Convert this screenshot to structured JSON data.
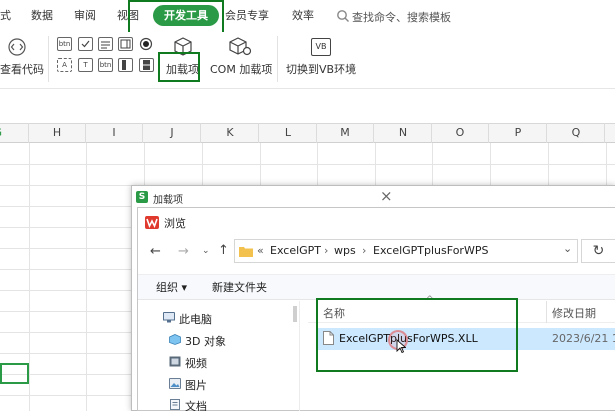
{
  "ribbon": {
    "tabs": [
      {
        "label": "式"
      },
      {
        "label": "数据"
      },
      {
        "label": "审阅"
      },
      {
        "label": "视图"
      },
      {
        "label": "开发工具"
      },
      {
        "label": "会员专享"
      },
      {
        "label": "效率"
      }
    ],
    "search_placeholder": "查找命令、搜索模板",
    "view_code": "查看代码",
    "addins": "加载项",
    "com_addins": "COM 加载项",
    "switch_vb": "切换到VB环境",
    "ctrl_btn": "btn",
    "ctrl_a": "A",
    "ctrl_t": "T",
    "ctrl_vb": "VB"
  },
  "sheet": {
    "columns": [
      "G",
      "H",
      "I",
      "J",
      "K",
      "L",
      "M",
      "N",
      "O",
      "P",
      "Q"
    ]
  },
  "addin_dialog": {
    "title": "加载项",
    "app_badge": "S",
    "close_glyph": "×"
  },
  "browse_dialog": {
    "title": "浏览",
    "breadcrumb_prefix": "«",
    "breadcrumb": [
      "ExcelGPT",
      "wps",
      "ExcelGPTplusForWPS"
    ],
    "organize": "组织 ▾",
    "new_folder": "新建文件夹",
    "sidebar": [
      "此电脑",
      "3D 对象",
      "视频",
      "图片",
      "文档"
    ],
    "column_name": "名称",
    "column_modified": "修改日期",
    "file": {
      "name": "ExcelGPTplusForWPS.XLL",
      "date": "2023/6/21 1"
    }
  },
  "colors": {
    "accent": "#2b9a46",
    "highlight": "#0f7a1f",
    "selection": "#cce8ff"
  }
}
